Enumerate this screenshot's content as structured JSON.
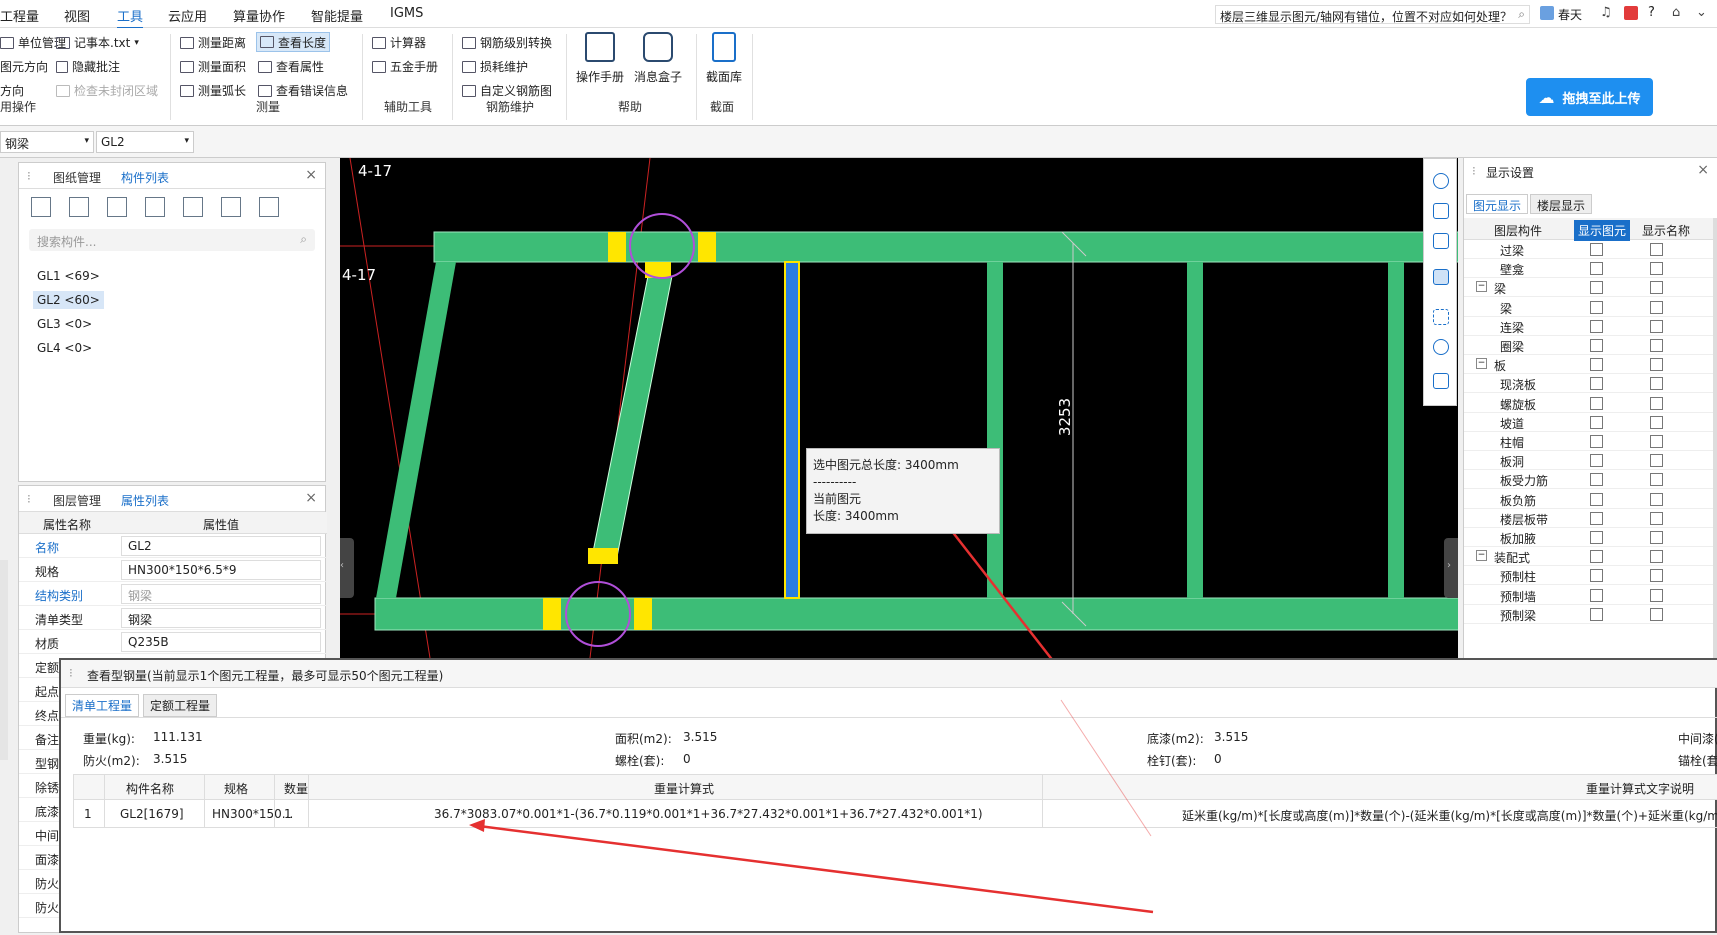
{
  "menu": {
    "items": [
      "工程量",
      "视图",
      "工具",
      "云应用",
      "算量协作",
      "智能提量",
      "IGMS"
    ],
    "active": "工具"
  },
  "topbar": {
    "question": "楼层三维显示图元/轴网有错位，位置不对应如何处理？",
    "user": "春天",
    "help": "?"
  },
  "ribbon": {
    "left_items": [
      "单位管理",
      "记事本.txt",
      "图元方向",
      "隐藏批注",
      "方向",
      "检查未封闭区域"
    ],
    "left_group": "用操作",
    "measure": [
      "测量距离",
      "查看长度",
      "测量面积",
      "查看属性",
      "测量弧长",
      "查看错误信息"
    ],
    "measure_group": "测量",
    "aux": [
      "计算器",
      "五金手册"
    ],
    "aux_group": "辅助工具",
    "rebar": [
      "钢筋级别转换",
      "损耗维护",
      "自定义钢筋图"
    ],
    "rebar_group": "钢筋维护",
    "help": [
      "操作手册",
      "消息盒子"
    ],
    "help_group": "帮助",
    "section": [
      "截面库"
    ],
    "section_group": "截面",
    "upload": "拖拽至此上传"
  },
  "combos": {
    "type": "钢梁",
    "name": "GL2"
  },
  "left_top": {
    "tabs": [
      "图纸管理",
      "构件列表"
    ],
    "active_tab": "构件列表",
    "search_placeholder": "搜索构件...",
    "items": [
      "GL1 <69>",
      "GL2 <60>",
      "GL3 <0>",
      "GL4 <0>"
    ],
    "selected": "GL2 <60>"
  },
  "left_bottom": {
    "tabs": [
      "图层管理",
      "属性列表"
    ],
    "active_tab": "属性列表",
    "headers": [
      "属性名称",
      "属性值"
    ],
    "rows": [
      {
        "k": "名称",
        "v": "GL2"
      },
      {
        "k": "规格",
        "v": "HN300*150*6.5*9"
      },
      {
        "k": "结构类别",
        "v": "钢梁"
      },
      {
        "k": "清单类型",
        "v": "钢梁"
      },
      {
        "k": "材质",
        "v": "Q235B"
      },
      {
        "k": "定额",
        "v": ""
      },
      {
        "k": "起点",
        "v": ""
      },
      {
        "k": "终点",
        "v": ""
      },
      {
        "k": "备注",
        "v": ""
      },
      {
        "k": "型钢",
        "v": ""
      },
      {
        "k": "除锈",
        "v": ""
      },
      {
        "k": "底漆",
        "v": ""
      },
      {
        "k": "中间",
        "v": ""
      },
      {
        "k": "面漆",
        "v": ""
      },
      {
        "k": "防火",
        "v": ""
      },
      {
        "k": "防火",
        "v": ""
      }
    ]
  },
  "canvas": {
    "axis_label_1": "4-17",
    "axis_label_2": "4-17",
    "dimension": "3253",
    "tooltip": {
      "line1": "选中图元总长度: 3400mm",
      "line2": "----------",
      "line3": "当前图元",
      "line4": "长度: 3400mm"
    }
  },
  "right_panel": {
    "title": "显示设置",
    "tabs": [
      "图元显示",
      "楼层显示"
    ],
    "active_tab": "图元显示",
    "headers": [
      "图层构件",
      "显示图元",
      "显示名称"
    ],
    "rows": [
      {
        "name": "过梁",
        "level": 2
      },
      {
        "name": "壁龛",
        "level": 2
      },
      {
        "name": "梁",
        "level": 1
      },
      {
        "name": "梁",
        "level": 2
      },
      {
        "name": "连梁",
        "level": 2
      },
      {
        "name": "圈梁",
        "level": 2
      },
      {
        "name": "板",
        "level": 1
      },
      {
        "name": "现浇板",
        "level": 2
      },
      {
        "name": "螺旋板",
        "level": 2
      },
      {
        "name": "坡道",
        "level": 2
      },
      {
        "name": "柱帽",
        "level": 2
      },
      {
        "name": "板洞",
        "level": 2
      },
      {
        "name": "板受力筋",
        "level": 2
      },
      {
        "name": "板负筋",
        "level": 2
      },
      {
        "name": "楼层板带",
        "level": 2
      },
      {
        "name": "板加腋",
        "level": 2
      },
      {
        "name": "装配式",
        "level": 1
      },
      {
        "name": "预制柱",
        "level": 2
      },
      {
        "name": "预制墙",
        "level": 2
      },
      {
        "name": "预制梁",
        "level": 2
      }
    ]
  },
  "steel_panel": {
    "title": "查看型钢量(当前显示1个图元工程量，最多可显示50个图元工程量)",
    "tabs": [
      "清单工程量",
      "定额工程量"
    ],
    "active_tab": "清单工程量",
    "summary": [
      {
        "label": "重量(kg):",
        "value": "111.131"
      },
      {
        "label": "面积(m2):",
        "value": "3.515"
      },
      {
        "label": "底漆(m2):",
        "value": "3.515"
      },
      {
        "label": "中间漆(",
        "value": ""
      },
      {
        "label": "防火(m2):",
        "value": "3.515"
      },
      {
        "label": "螺栓(套):",
        "value": "0"
      },
      {
        "label": "栓钉(套):",
        "value": "0"
      },
      {
        "label": "锚栓(套",
        "value": ""
      }
    ],
    "headers": [
      "构件名称",
      "规格",
      "数量",
      "重量计算式",
      "重量计算式文字说明"
    ],
    "rows": [
      {
        "idx": "1",
        "name": "GL2[1679]",
        "spec": "HN300*150...",
        "qty": "1",
        "formula": "36.7*3083.07*0.001*1-(36.7*0.119*0.001*1+36.7*27.432*0.001*1+36.7*27.432*0.001*1)",
        "desc": "延米重(kg/m)*[长度或高度(m)]*数量(个)-(延米重(kg/m)*[长度或高度(m)]*数量(个)+延米重(kg/m)*[长"
      }
    ]
  },
  "colors": {
    "accent": "#1a6fc9",
    "beam": "#3dbd77",
    "highlight": "#ffe600",
    "arrow": "#e53030",
    "circle": "#b04fd9"
  }
}
